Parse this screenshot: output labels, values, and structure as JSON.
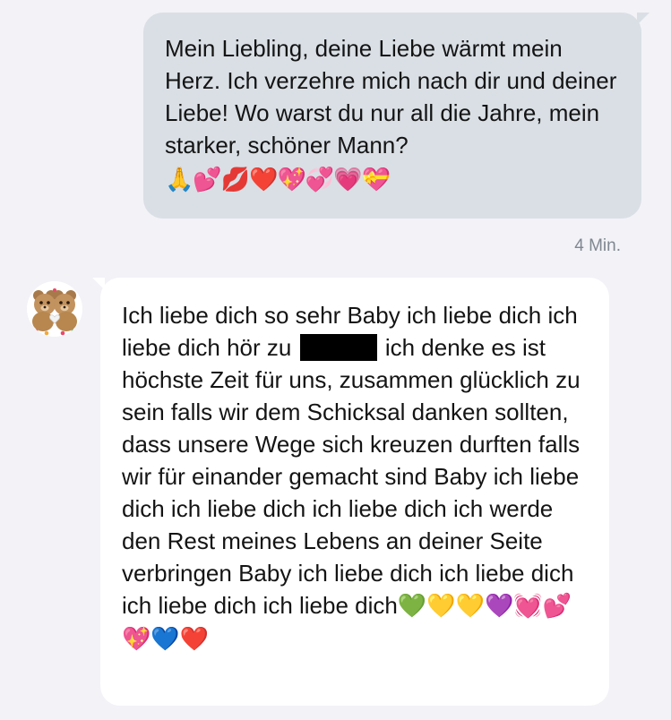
{
  "messages": {
    "outgoing": {
      "text": "Mein Liebling, deine Liebe wärmt mein Herz. Ich verzehre mich nach dir und deiner Liebe! Wo warst du nur all die Jahre, mein starker, schöner Mann?",
      "emojis": "🙏💕💋❤️💖💞💗💝",
      "time": "4 Min."
    },
    "incoming": {
      "text_before_redaction": "Ich liebe dich so sehr Baby ich liebe dich ich liebe dich hör zu",
      "text_after_redaction": "ich denke es ist höchste Zeit für uns, zusammen glücklich zu sein falls wir dem Schicksal danken sollten, dass unsere Wege sich kreuzen durften falls wir für einander gemacht sind Baby ich liebe dich ich liebe dich ich liebe dich ich werde den Rest meines Lebens an deiner Seite verbringen Baby ich liebe dich ich liebe dich ich liebe dich ich liebe dich",
      "emojis": "💚💛💛💜💓💕💖💙❤️",
      "avatar_icon": "teddy-bears-avatar"
    }
  }
}
